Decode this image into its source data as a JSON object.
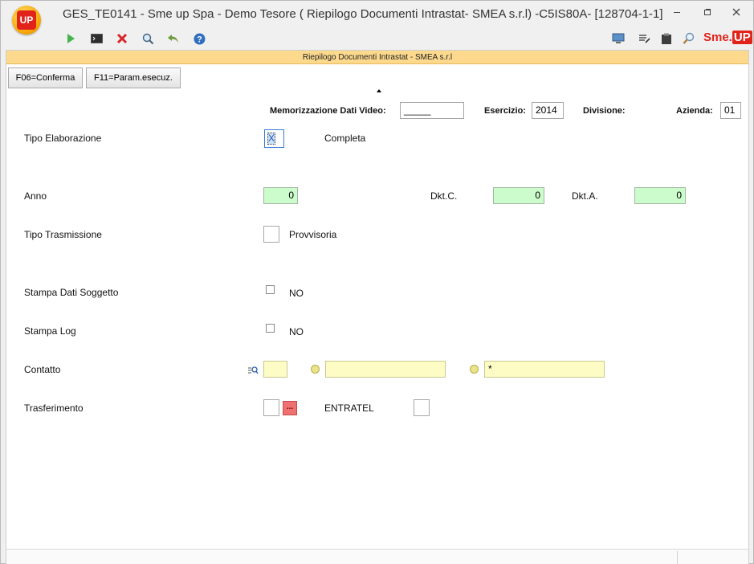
{
  "window": {
    "app_logo_text": "UP",
    "title": "GES_TE0141 - Sme up Spa  - Demo Tesore ( Riepilogo Documenti Intrastat- SMEA s.r.l) -C5IS80A- [128704-1-1]",
    "minimize_icon": "minimize-icon",
    "restore_icon": "restore-icon",
    "close_icon": "close-icon"
  },
  "toolbar": {
    "brand_part1": "Sme.",
    "brand_part2": "UP"
  },
  "header": {
    "title": "Riepilogo Documenti Intrastat -  SMEA s.r.l"
  },
  "buttons": {
    "f06": "F06=Conferma",
    "f11": "F11=Param.esecuz."
  },
  "top_fields": {
    "memorizzazione_label": "Memorizzazione Dati Video:",
    "memorizzazione_value": "_____",
    "esercizio_label": "Esercizio:",
    "esercizio_value": "2014",
    "divisione_label": "Divisione:",
    "azienda_label": "Azienda:",
    "azienda_value": "01"
  },
  "form": {
    "tipo_elaborazione_label": "Tipo Elaborazione",
    "tipo_elaborazione_mark": "X",
    "tipo_elaborazione_desc": "Completa",
    "anno_label": "Anno",
    "anno_value": "0",
    "dktc_label": "Dkt.C.",
    "dktc_value": "0",
    "dkta_label": "Dkt.A.",
    "dkta_value": "0",
    "tipo_trasmissione_label": "Tipo Trasmissione",
    "tipo_trasmissione_value": "",
    "tipo_trasmissione_desc": "Provvisoria",
    "stampa_dati_label": "Stampa Dati Soggetto",
    "stampa_dati_value": "NO",
    "stampa_log_label": "Stampa Log",
    "stampa_log_value": "NO",
    "contatto_label": "Contatto",
    "contatto_value1": "",
    "contatto_value2": "",
    "contatto_value3": "*",
    "trasferimento_label": "Trasferimento",
    "trasferimento_value": "",
    "trasferimento_btn": "...",
    "entratel_label": "ENTRATEL",
    "entratel_value": ""
  },
  "colors": {
    "header_band": "#fcd98d",
    "green_field": "#ccfccc",
    "yellow_field": "#fcfcc4",
    "brand_red": "#e2231a"
  }
}
